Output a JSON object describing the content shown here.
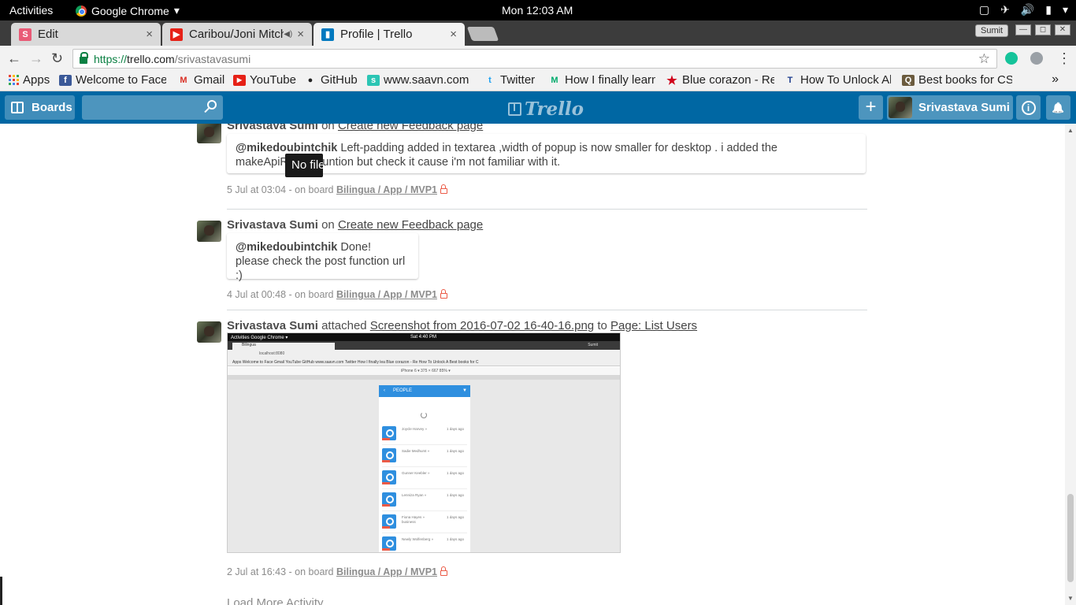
{
  "os": {
    "activities": "Activities",
    "app": "Google Chrome",
    "app_arrow": "▾",
    "clock": "Mon 12:03 AM",
    "tray_icons": [
      "square-icon",
      "airplane-icon",
      "volume-icon",
      "battery-icon",
      "chevron-down-icon"
    ],
    "tray_glyphs": [
      "▢",
      "✈",
      "🔊",
      "▮",
      "▾"
    ]
  },
  "tabs": [
    {
      "label": "Edit",
      "favicon_letter": "S",
      "favicon_color": "#e95a76",
      "close": "×"
    },
    {
      "label": "Caribou/Joni Mitchell",
      "favicon_color": "#e62117",
      "mute": "◀)",
      "close": "×"
    },
    {
      "label": "Profile | Trello",
      "favicon_color": "#0079bf",
      "close": "×"
    }
  ],
  "window": {
    "user": "Sumit",
    "minimize": "—",
    "restore": "◻",
    "close": "✕"
  },
  "toolbar": {
    "back": "←",
    "forward": "→",
    "reload": "↻",
    "url_scheme": "https://",
    "url_host": "trello.com",
    "url_path": "/srivastavasumi",
    "bookmark_star": "☆",
    "menu": "⋮"
  },
  "bookmarks": [
    {
      "label": "Apps",
      "icon": "apps-icon",
      "color": "#4285f4"
    },
    {
      "label": "Welcome to Facebook",
      "icon": "facebook-icon",
      "color": "#3b5998",
      "glyph": "f"
    },
    {
      "label": "Gmail",
      "icon": "gmail-icon",
      "color": "#d93025",
      "glyph": "M"
    },
    {
      "label": "YouTube",
      "icon": "youtube-icon",
      "color": "#e62117",
      "glyph": "▶"
    },
    {
      "label": "GitHub",
      "icon": "github-icon",
      "color": "#222222",
      "glyph": "●"
    },
    {
      "label": "www.saavn.com",
      "icon": "saavn-icon",
      "color": "#2bc5b4",
      "glyph": "s"
    },
    {
      "label": "Twitter",
      "icon": "twitter-icon",
      "color": "#1da1f2",
      "glyph": "t"
    },
    {
      "label": "How I finally learned",
      "icon": "medium-icon",
      "color": "#00ab6c",
      "glyph": "M"
    },
    {
      "label": "Blue corazon - Red",
      "icon": "star-icon",
      "color": "#d0021b",
      "glyph": "★"
    },
    {
      "label": "How To Unlock All",
      "icon": "site-icon",
      "color": "#1b3a8c",
      "glyph": "T"
    },
    {
      "label": "Best books for CS",
      "icon": "quora-icon",
      "color": "#6b5b3e",
      "glyph": "Q"
    }
  ],
  "bookmarks_more": "»",
  "trello": {
    "boards_label": "Boards",
    "logo_text": "Trello",
    "add": "+",
    "member_name": "Srivastava Sumi",
    "info": "i",
    "bell": "🔔"
  },
  "activities": [
    {
      "user": "Srivastava Sumi",
      "verb": "on",
      "card_link": "Create new Feedback page",
      "comment_mention": "@mikedoubintchik",
      "comment_text": " Left-padding added in textarea ,width of popup is now smaller for desktop . i added the makeApiRequst funtion but check it cause i'm not familiar with it.",
      "date": "5 Jul at 03:04 - on board ",
      "board": "Bilingua / App / MVP1"
    },
    {
      "user": "Srivastava Sumi",
      "verb": "on",
      "card_link": "Create new Feedback page",
      "comment_mention": "@mikedoubintchik",
      "comment_line1": " Done!",
      "comment_line2": "please check the post function url :)",
      "date": "4 Jul at 00:48 - on board ",
      "board": "Bilingua / App / MVP1"
    },
    {
      "user": "Srivastava Sumi",
      "verb": "attached",
      "attachment_link": "Screenshot from 2016-07-02 16-40-16.png",
      "to": "to",
      "card_link": "Page: List Users",
      "date": "2 Jul at 16:43 - on board ",
      "board": "Bilingua / App / MVP1"
    }
  ],
  "tooltip": "No file",
  "load_more": "Load More Activity",
  "attachment_thumb": {
    "top_left": "Activities   Google Chrome ▾",
    "clock": "Sat 4:40 PM",
    "tab": "Bilingua",
    "url": "localhost:8080",
    "user": "Sumit",
    "bookmarks": "Apps  Welcome to Face   Gmail   YouTube   GitHub   www.saavn.com   Twitter   How I finally lea   Blue corazon - Re   How To Unlock A   Best books for C",
    "device": "iPhone 6 ▾    375  ×  667    85% ▾",
    "header": "PEOPLE",
    "back": "‹",
    "filter": "▼",
    "people": [
      {
        "name": "Joycle Harvey »",
        "age": "1 days ago",
        "sub": ""
      },
      {
        "name": "Sadie Medhurst »",
        "age": "1 days ago",
        "sub": ""
      },
      {
        "name": "Gunner Keebler »",
        "age": "1 days ago",
        "sub": ""
      },
      {
        "name": "Lenniza Ryan »",
        "age": "1 days ago",
        "sub": ""
      },
      {
        "name": "Fiona Hayes »",
        "age": "1 days ago",
        "sub": "business"
      },
      {
        "name": "Newly Wolfenberg »",
        "age": "1 days ago",
        "sub": ""
      }
    ]
  }
}
